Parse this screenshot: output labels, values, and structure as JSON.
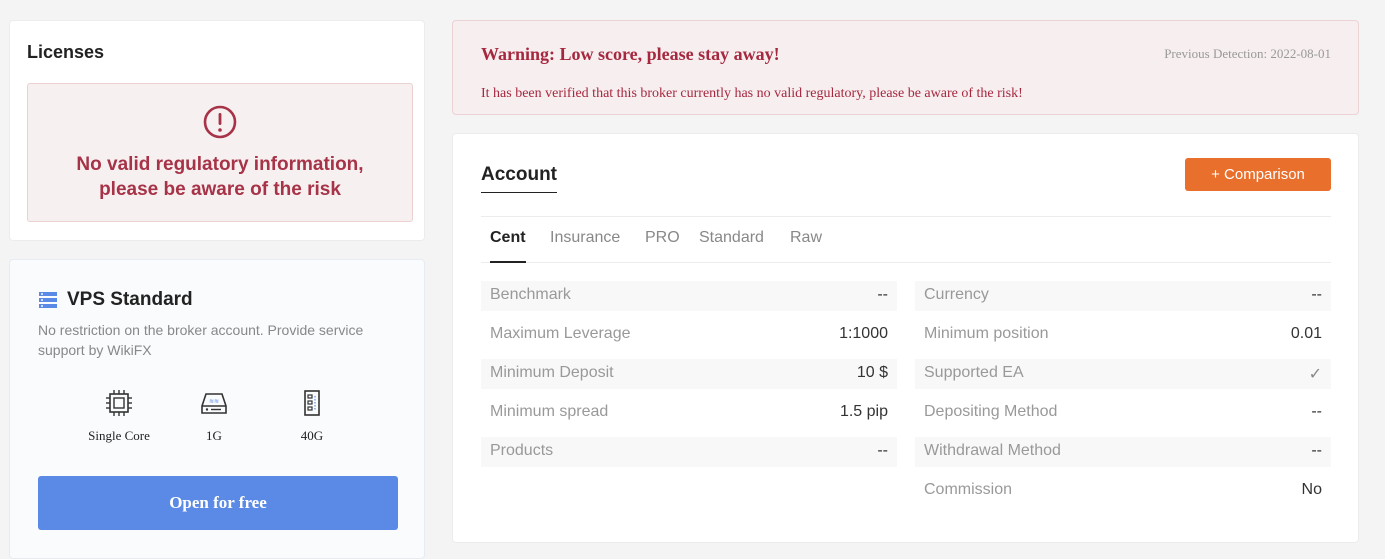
{
  "licenses": {
    "title": "Licenses",
    "alert_line1": "No valid regulatory information,",
    "alert_line2": "please be aware of the risk"
  },
  "vps": {
    "title": "VPS Standard",
    "description": "No restriction on the broker account. Provide service support by WikiFX",
    "specs": [
      {
        "icon": "cpu-icon",
        "label": "Single Core"
      },
      {
        "icon": "memory-icon",
        "label": "1G"
      },
      {
        "icon": "storage-icon",
        "label": "40G"
      }
    ],
    "button": "Open for free"
  },
  "warning": {
    "title": "Warning: Low score, please stay away!",
    "detection": "Previous Detection: 2022-08-01",
    "message": "It has been verified that this broker currently has no valid regulatory, please be aware of the risk!"
  },
  "account": {
    "title": "Account",
    "comparison_button": "+ Comparison",
    "tabs": [
      "Cent",
      "Insurance",
      "PRO",
      "Standard",
      "Raw"
    ],
    "active_tab": "Cent",
    "left": [
      {
        "key": "Benchmark",
        "value": "--"
      },
      {
        "key": "Maximum Leverage",
        "value": "1:1000"
      },
      {
        "key": "Minimum Deposit",
        "value": "10 $"
      },
      {
        "key": "Minimum spread",
        "value": "1.5 pip"
      },
      {
        "key": "Products",
        "value": "--"
      }
    ],
    "right": [
      {
        "key": "Currency",
        "value": "--"
      },
      {
        "key": "Minimum position",
        "value": "0.01"
      },
      {
        "key": "Supported EA",
        "value": "✓"
      },
      {
        "key": "Depositing Method",
        "value": "--"
      },
      {
        "key": "Withdrawal Method",
        "value": "--"
      },
      {
        "key": "Commission",
        "value": "No"
      }
    ]
  },
  "colors": {
    "danger": "#a63347",
    "accent_orange": "#e86f2c",
    "button_blue": "#5b8ae6"
  }
}
